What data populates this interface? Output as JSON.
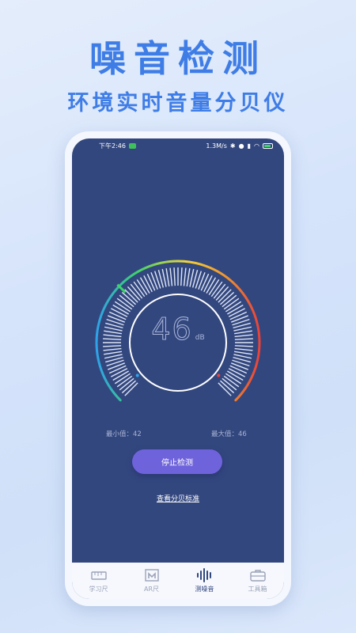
{
  "promo": {
    "title": "噪音检测",
    "subtitle": "环境实时音量分贝仪"
  },
  "status_bar": {
    "time": "下午2:46",
    "network_speed": "1.3M/s",
    "icons": [
      "wechat-icon",
      "bluetooth-icon",
      "alarm-icon",
      "silent-icon",
      "signal-icon",
      "hd-icon",
      "wifi-icon",
      "battery-icon"
    ]
  },
  "meter": {
    "value": "46",
    "unit": "dB",
    "level": 46,
    "min_label": "最小值：42",
    "max_label": "最大值：46",
    "colors": [
      "#2ea3e8",
      "#3fd36b",
      "#f2d33a",
      "#f0922c",
      "#e8423a"
    ]
  },
  "actions": {
    "stop_label": "停止检测",
    "standard_link": "查看分贝标准"
  },
  "tabs": [
    {
      "label": "学习尺",
      "icon": "ruler-icon",
      "active": false
    },
    {
      "label": "AR尺",
      "icon": "ar-ruler-icon",
      "active": false
    },
    {
      "label": "测噪音",
      "icon": "sound-wave-icon",
      "active": true
    },
    {
      "label": "工具箱",
      "icon": "toolbox-icon",
      "active": false
    }
  ]
}
